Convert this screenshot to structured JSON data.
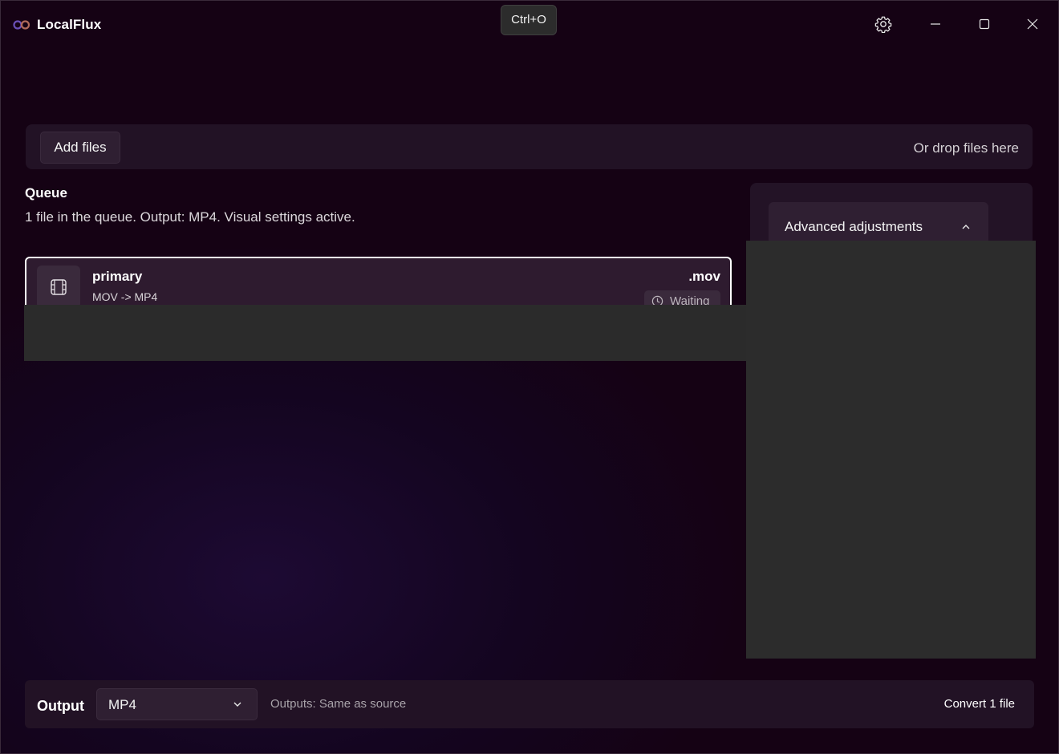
{
  "app": {
    "title": "LocalFlux"
  },
  "tooltip": {
    "text": "Ctrl+O"
  },
  "titlebar": {
    "icons": [
      "gear-icon",
      "minimize-icon",
      "maximize-icon",
      "close-icon"
    ]
  },
  "dropzone": {
    "add_files_label": "Add files",
    "drop_hint": "Or drop files here"
  },
  "queue": {
    "title": "Queue",
    "summary": "1 file in the queue. Output: MP4. Visual settings active.",
    "items": [
      {
        "name": "primary",
        "conversion": "MOV -> MP4",
        "extension": ".mov",
        "status": "Waiting",
        "icon": "film-icon",
        "status_icon": "clock-icon"
      }
    ]
  },
  "side_panel": {
    "advanced_label": "Advanced adjustments",
    "expanded": true
  },
  "output_bar": {
    "label": "Output",
    "format_selected": "MP4",
    "outputs_text": "Outputs: Same as source",
    "convert_label": "Convert 1 file"
  },
  "colors": {
    "background": "#160215",
    "panel": "#221225",
    "control": "#2f1f32",
    "occlusion": "#2c2c2c",
    "text": "#ffffff",
    "muted_text": "#a9a3aa"
  }
}
